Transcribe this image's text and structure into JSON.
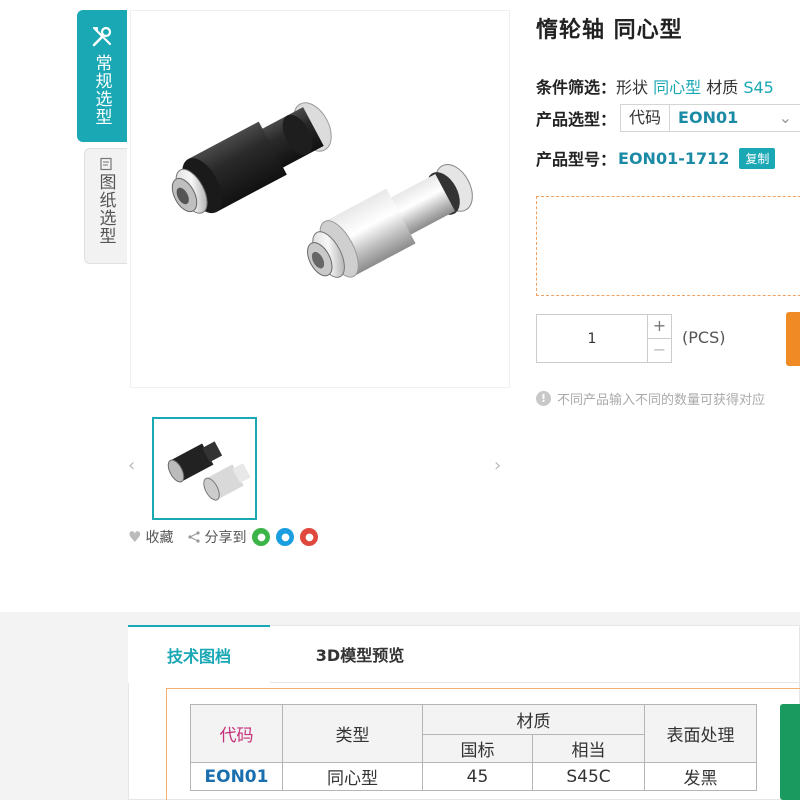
{
  "side_tabs": {
    "active_label": "常规选型",
    "inactive_label": "图纸选型"
  },
  "product": {
    "title": "惰轮轴 同心型",
    "filter_label": "条件筛选：",
    "filter_shape_key": "形状",
    "filter_shape_val": "同心型",
    "filter_material_key": "材质",
    "filter_material_val": "S45",
    "select_label": "产品选型：",
    "select_field_label": "代码",
    "select_value": "EON01",
    "model_label": "产品型号：",
    "model_number": "EON01-1712",
    "copy_label": "复制"
  },
  "quantity": {
    "value": "1",
    "plus": "+",
    "minus": "−",
    "unit": "(PCS)"
  },
  "note": {
    "icon": "!",
    "text": "不同产品输入不同的数量可获得对应"
  },
  "gallery": {
    "prev": "‹",
    "next": "›",
    "favorite_label": "收藏",
    "share_label": "分享到",
    "social_icons": [
      "wechat-icon",
      "qq-icon",
      "weibo-icon"
    ],
    "social_colors": [
      "#3bb54a",
      "#1a9ee0",
      "#e0483e"
    ]
  },
  "lower_tabs": {
    "tech_docs": "技术图档",
    "model_3d": "3D模型预览"
  },
  "spec_table": {
    "headers": {
      "code": "代码",
      "type": "类型",
      "material": "材质",
      "gb": "国标",
      "equiv": "相当",
      "surface": "表面处理"
    },
    "row": {
      "code": "EON01",
      "type": "同心型",
      "gb": "45",
      "equiv": "S45C",
      "surface": "发黑"
    }
  },
  "colors": {
    "accent": "#1ba8b5",
    "buy_button": "#f08a24",
    "side_button": "#1a9a5e",
    "code_header": "#c4327a"
  }
}
